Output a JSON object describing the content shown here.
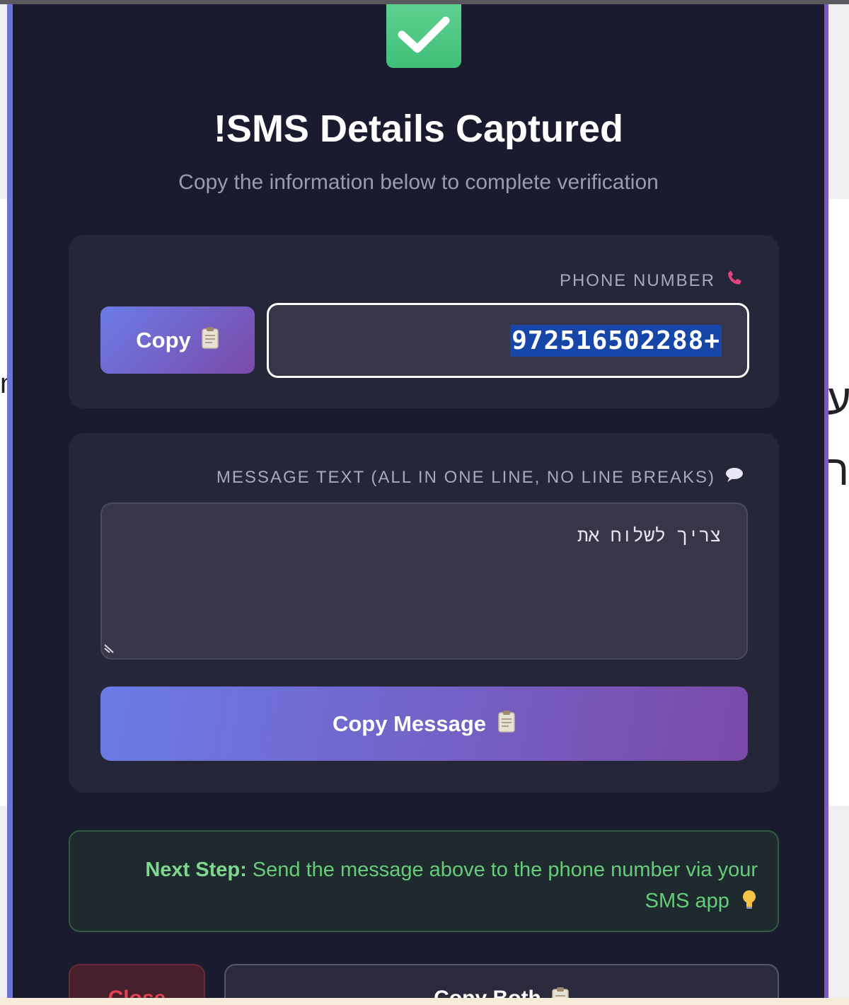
{
  "background": {
    "left_fragment": "n",
    "right_fragment_1": "ע",
    "right_fragment_2": "ר"
  },
  "modal": {
    "success_icon": "checkmark-icon",
    "title": "!SMS Details Captured",
    "subtitle": "Copy the information below to complete verification"
  },
  "phone": {
    "label": "PHONE NUMBER",
    "label_icon": "phone-icon",
    "copy_label": "Copy",
    "copy_icon": "clipboard-icon",
    "value": "972516502288+"
  },
  "message": {
    "label": "MESSAGE TEXT (ALL IN ONE LINE, NO LINE BREAKS)",
    "label_icon": "speech-bubble-icon",
    "value": "צריך לשלוח את",
    "copy_label": "Copy Message",
    "copy_icon": "clipboard-icon"
  },
  "next_step": {
    "heading": "Next Step:",
    "text": "Send the message above to the phone number via your SMS app",
    "icon": "lightbulb-icon"
  },
  "actions": {
    "close_label": "Close",
    "copy_both_label": "Copy Both",
    "copy_both_icon": "clipboard-icon"
  },
  "colors": {
    "modal_bg": "#1a1b2e",
    "card_bg": "#252637",
    "accent_start": "#6a7ce6",
    "accent_end": "#7b4aa8",
    "success": "#4cc985",
    "next_step_text": "#66cc7a",
    "close_text": "#e0454f"
  }
}
